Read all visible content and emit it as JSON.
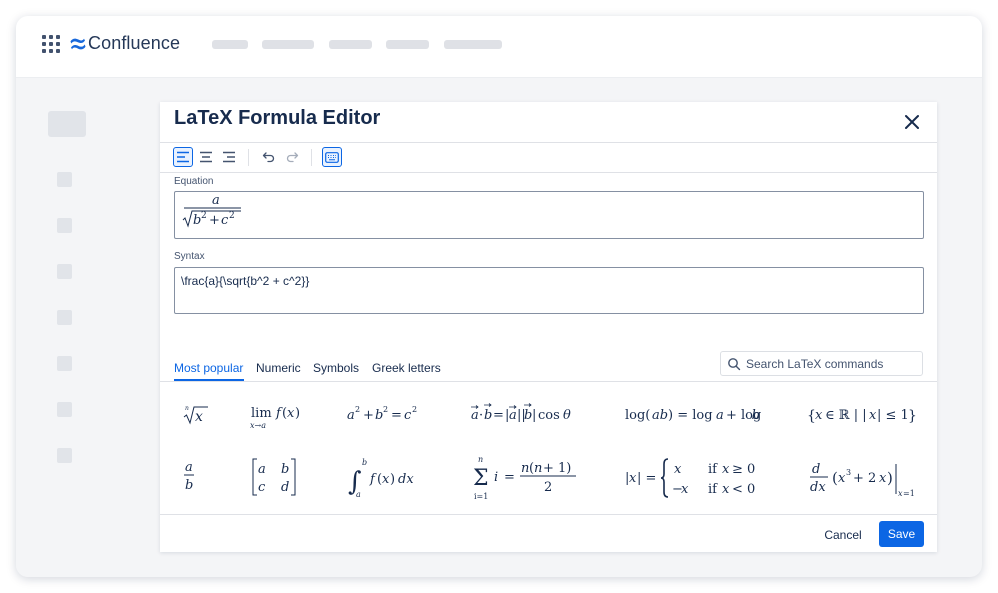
{
  "app": {
    "title": "Confluence"
  },
  "dialog": {
    "title": "LaTeX Formula Editor",
    "equation_label": "Equation",
    "syntax_label": "Syntax",
    "syntax_value": "\\frac{a}{\\sqrt{b^2 + c^2}}",
    "tabs": [
      {
        "label": "Most popular",
        "active": true
      },
      {
        "label": "Numeric"
      },
      {
        "label": "Symbols"
      },
      {
        "label": "Greek letters"
      }
    ],
    "search_placeholder": "Search LaTeX commands",
    "cancel_label": "Cancel",
    "save_label": "Save"
  },
  "formulas": {
    "r1": [
      "√x",
      "lim f(x)",
      "a² + b² = c²",
      "a·b = |a||b| cos θ",
      "log(ab) = log a + log b",
      "{x ∈ ℝ | |x| ≤ 1}"
    ],
    "r2": [
      "a/b",
      "[a b; c d]",
      "∫ f(x) dx",
      "Σ i = n(n+1)/2",
      "|x| piecewise",
      "d/dx (x³ + 2x)"
    ]
  },
  "icons": [
    "app-grid-icon",
    "confluence-logo-icon",
    "close-icon",
    "align-left-icon",
    "align-center-icon",
    "align-right-icon",
    "undo-icon",
    "redo-icon",
    "keyboard-icon",
    "search-icon"
  ],
  "colors": {
    "accent": "#0c66e4",
    "text": "#172b4d"
  }
}
